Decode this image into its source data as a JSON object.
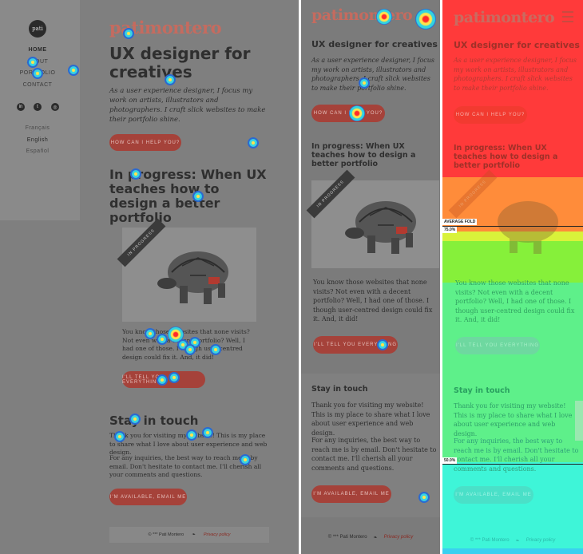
{
  "site": {
    "logo": "patimontero",
    "avatar_text": "pati",
    "nav": [
      "HOME",
      "ABOUT",
      "PORTFOLIO",
      "CONTACT"
    ],
    "languages": [
      "Français",
      "English",
      "Español"
    ],
    "social": [
      "linkedin-icon",
      "twitter-icon",
      "instagram-icon"
    ],
    "headline": "UX designer for creatives",
    "lead": "As a user experience designer, I focus my work on artists, illustrators and photographers. I craft slick websites to make their portfolio shine.",
    "cta": "HOW CAN I HELP YOU?",
    "progress_title": "In progress: When UX teaches how to design a better portfolio",
    "ribbon": "IN PROGRESS",
    "portfolio_text": "You know those websites that none visits? Not even with a decent portfolio? Well, I had one of those. I though user-centred design could fix it. And, it did!",
    "portfolio_cta": "I'LL TELL YOU EVERYTHING",
    "contact_title": "Stay in touch",
    "contact_p1": "Thank you for visiting my website! This is my place to share what I love about user experience and web design.",
    "contact_p2": "For any inquiries, the best way to reach me is by email. Don't hesitate to contact me. I'll cherish all your comments and questions.",
    "contact_cta": "I'M AVAILABLE, EMAIL ME",
    "footer_copy": "© *** Pati Montero",
    "footer_link": "Privacy policy"
  },
  "scrollmap": {
    "average_fold": "AVERAGE FOLD",
    "pct_75": "75.0%",
    "pct_50": "50.0%"
  },
  "colors": {
    "accent": "#a5423a",
    "logo": "#c56b5f"
  }
}
